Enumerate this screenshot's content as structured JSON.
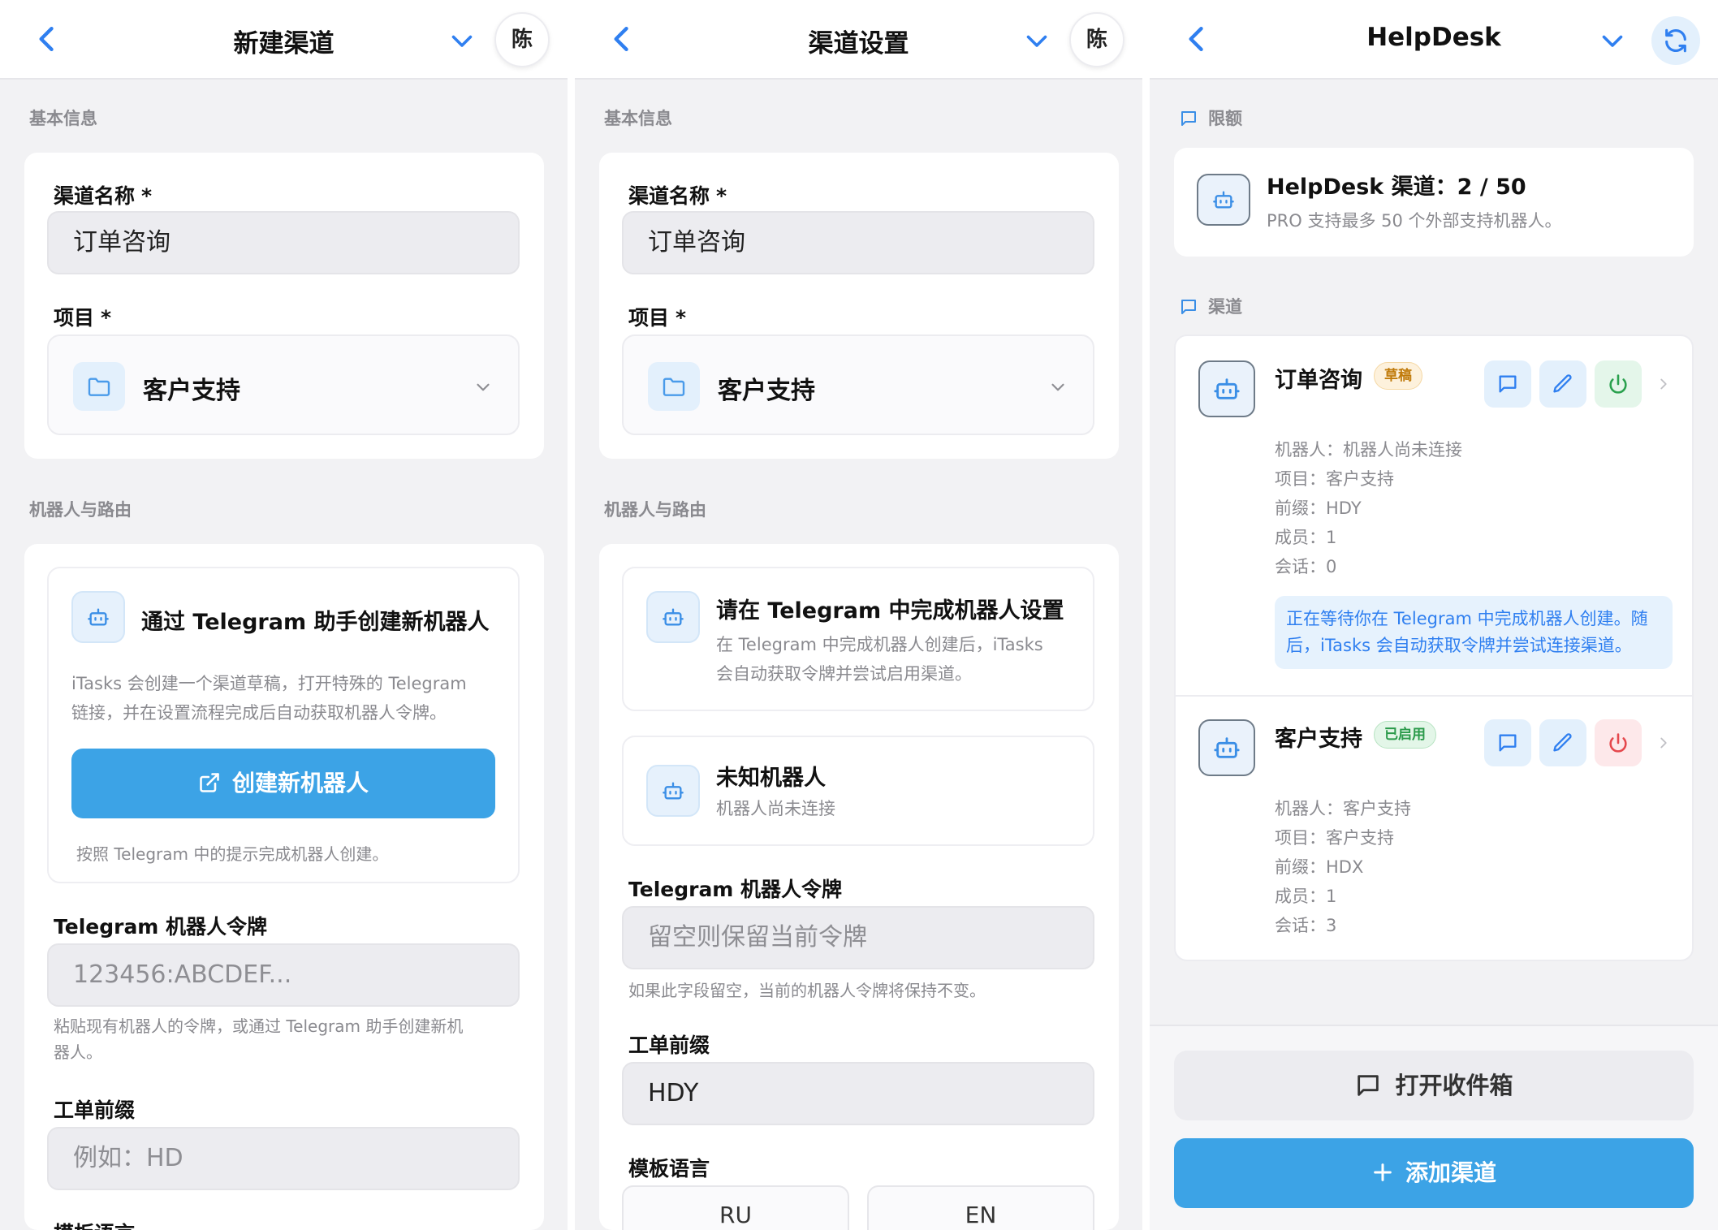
{
  "panel1": {
    "title": "新建渠道",
    "avatar": "陈",
    "section_basic": "基本信息",
    "name_label": "渠道名称",
    "required_mark": "*",
    "name_value": "订单咨询",
    "project_label": "项目",
    "project_value": "客户支持",
    "section_bot": "机器人与路由",
    "bot_card_title": "通过 Telegram 助手创建新机器人",
    "bot_card_desc_1": "iTasks 会创建一个渠道草稿，打开特殊的 Telegram",
    "bot_card_desc_2": "链接，并在设置流程完成后自动获取机器人令牌。",
    "create_button": "创建新机器人",
    "create_hint": "按照 Telegram 中的提示完成机器人创建。",
    "token_label": "Telegram 机器人令牌",
    "token_placeholder": "123456:ABCDEF...",
    "token_help_1": "粘贴现有机器人的令牌，或通过 Telegram 助手创建新机",
    "token_help_2": "器人。",
    "prefix_label": "工单前缀",
    "prefix_placeholder": "例如：HD",
    "lang_label": "模板语言"
  },
  "panel2": {
    "title": "渠道设置",
    "avatar": "陈",
    "section_basic": "基本信息",
    "name_label": "渠道名称",
    "required_mark": "*",
    "name_value": "订单咨询",
    "project_label": "项目",
    "project_value": "客户支持",
    "section_bot": "机器人与路由",
    "setup_title": "请在 Telegram 中完成机器人设置",
    "setup_desc_1": "在 Telegram 中完成机器人创建后，iTasks",
    "setup_desc_2": "会自动获取令牌并尝试启用渠道。",
    "unknown_title": "未知机器人",
    "unknown_desc": "机器人尚未连接",
    "token_label": "Telegram 机器人令牌",
    "token_placeholder": "留空则保留当前令牌",
    "token_help": "如果此字段留空，当前的机器人令牌将保持不变。",
    "prefix_label": "工单前缀",
    "prefix_value": "HDY",
    "lang_label": "模板语言",
    "lang_options": [
      "RU",
      "EN"
    ]
  },
  "panel3": {
    "title": "HelpDesk",
    "section_quota": "限额",
    "quota_title": "HelpDesk 渠道：",
    "quota_value": "2 / 50",
    "quota_sub": "PRO 支持最多 50 个外部支持机器人。",
    "section_channels": "渠道",
    "channels": [
      {
        "name": "订单咨询",
        "badge": "草稿",
        "bot": "机器人：机器人尚未连接",
        "project": "项目：客户支持",
        "prefix": "前缀：HDY",
        "members": "成员：1",
        "sessions": "会话：0",
        "note_1": "正在等待你在 Telegram 中完成机器人创建。随",
        "note_2": "后，iTasks 会自动获取令牌并尝试连接渠道。"
      },
      {
        "name": "客户支持",
        "badge": "已启用",
        "bot": "机器人：客户支持",
        "project": "项目：客户支持",
        "prefix": "前缀：HDX",
        "members": "成员：1",
        "sessions": "会话：3"
      }
    ],
    "inbox_button": "打开收件箱",
    "add_button": "添加渠道"
  },
  "colors": {
    "accent": "#2f7ff0",
    "primary_button": "#3ca3e6",
    "draft_badge": "#c07a0a",
    "enabled_badge": "#2a9a4a",
    "power_on": "#2aa14e",
    "power_off": "#e5484d"
  },
  "icons": [
    "back-icon",
    "chevron-down-icon",
    "refresh-icon",
    "folder-icon",
    "bot-icon",
    "external-link-icon",
    "message-icon",
    "pencil-icon",
    "power-icon",
    "chevron-right-icon",
    "plus-icon"
  ]
}
